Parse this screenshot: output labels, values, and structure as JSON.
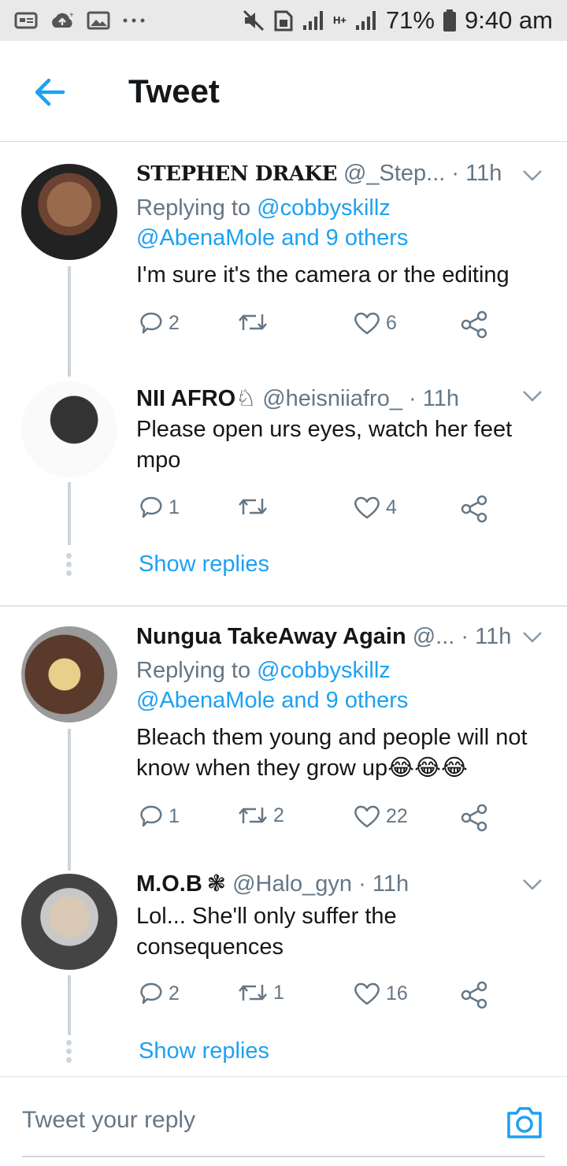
{
  "status_bar": {
    "network": "H+",
    "battery": "71%",
    "time": "9:40 am"
  },
  "header": {
    "title": "Tweet"
  },
  "tweets": [
    {
      "name": "STEPHEN DRAKE",
      "handle": "@_Step...",
      "time": "· 11h",
      "replying_prefix": "Replying to ",
      "replying_user": "@cobbyskillz",
      "replying_others": "@AbenaMole and 9 others",
      "text": "I'm sure it's the camera or the editing",
      "replies": "2",
      "retweets": "",
      "likes": "6"
    },
    {
      "name": "NII AFRO",
      "name_emoji": "♘",
      "handle": "@heisniiafro_",
      "time": "· 11h",
      "text": "Please open urs eyes, watch her feet mpo",
      "replies": "1",
      "retweets": "",
      "likes": "4"
    },
    {
      "name": "Nungua TakeAway Again",
      "handle": "@...",
      "time": "· 11h",
      "replying_prefix": "Replying to ",
      "replying_user": "@cobbyskillz",
      "replying_others": "@AbenaMole and 9 others",
      "text": "Bleach them young and people will not know when they grow up😂😂😂",
      "replies": "1",
      "retweets": "2",
      "likes": "22"
    },
    {
      "name": "M.O.B",
      "name_emoji": "❃",
      "handle": "@Halo_gyn",
      "time": "· 11h",
      "text": "Lol... She'll only suffer the consequences",
      "replies": "2",
      "retweets": "1",
      "likes": "16"
    }
  ],
  "show_replies_label": "Show replies",
  "reply_bar": {
    "placeholder": "Tweet your reply"
  },
  "colors": {
    "accent": "#1da1f2",
    "secondary_text": "#657786",
    "thread_line": "#ccd6dd"
  }
}
